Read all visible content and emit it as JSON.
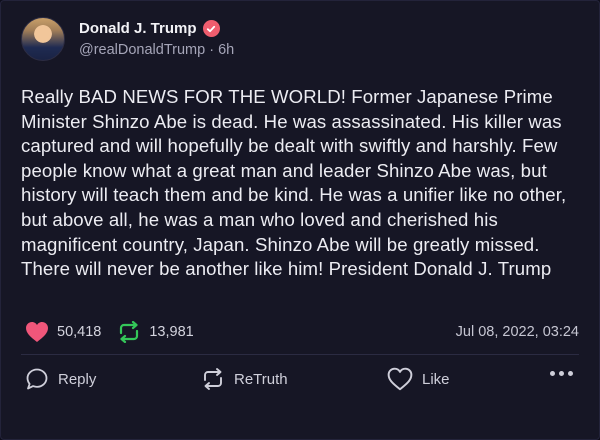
{
  "author": {
    "display_name": "Donald J. Trump",
    "handle": "@realDonaldTrump",
    "age": "6h",
    "verified": true
  },
  "post": {
    "text": "Really BAD NEWS FOR THE WORLD! Former Japanese Prime Minister Shinzo Abe is dead. He was assassinated. His killer was captured and will hopefully be dealt with swiftly and harshly. Few people know what a great man and leader Shinzo Abe was, but history will teach them and be kind. He was a unifier like no other, but above all, he was a man who loved and cherished his magnificent country, Japan. Shinzo Abe will be greatly missed. There will never be another like him! President Donald J. Trump"
  },
  "stats": {
    "likes": "50,418",
    "retruths": "13,981",
    "timestamp": "Jul 08, 2022, 03:24"
  },
  "actions": {
    "reply_label": "Reply",
    "retruth_label": "ReTruth",
    "like_label": "Like"
  },
  "icons": {
    "verified": "verified-badge-icon",
    "like_filled": "heart-icon",
    "retruth": "retruth-icon",
    "reply": "speech-bubble-icon",
    "like": "heart-outline-icon",
    "more": "ellipsis-icon"
  },
  "colors": {
    "background": "#161625",
    "verified_badge": "#ef5d6e",
    "like_heart": "#f0567a",
    "retruth_green": "#34c759",
    "text": "#ececf2",
    "muted": "#a5a5b8"
  }
}
